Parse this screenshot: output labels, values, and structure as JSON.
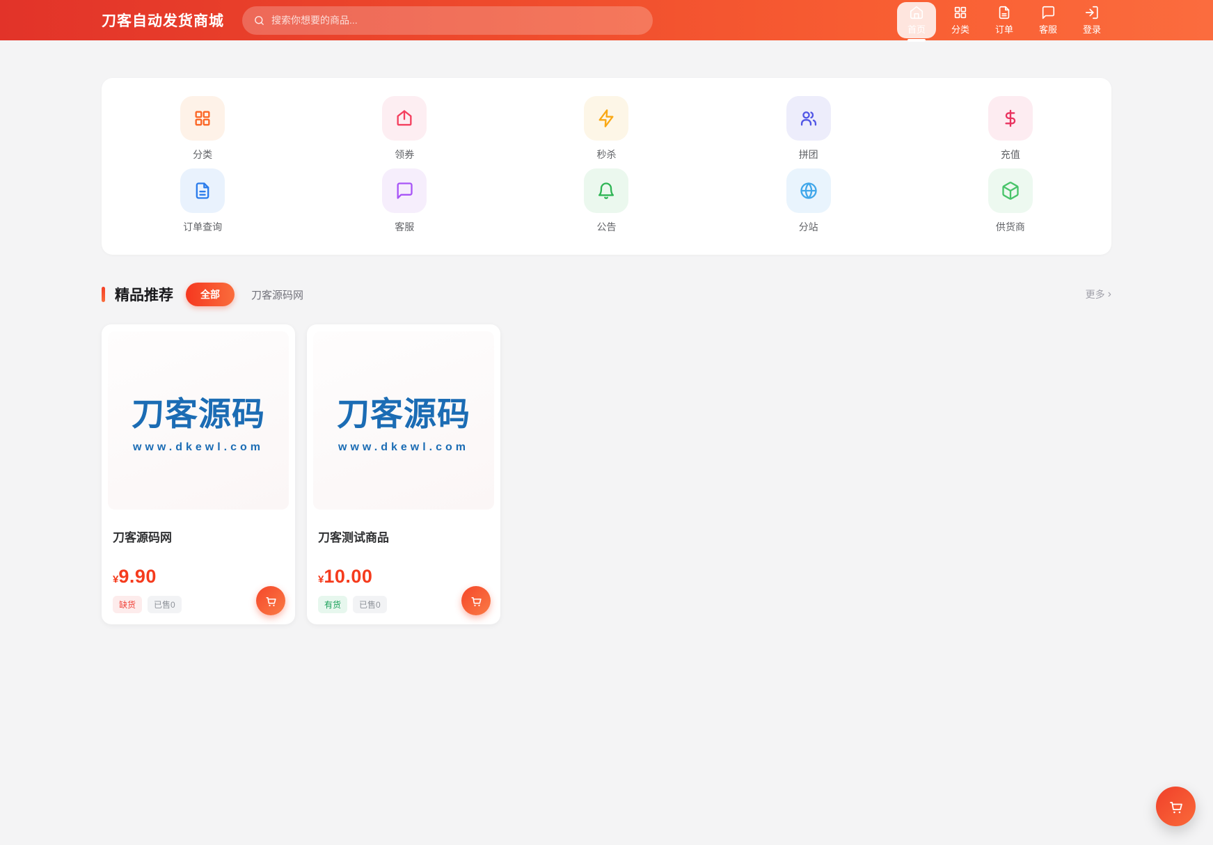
{
  "header": {
    "logo": "刀客自动发货商城",
    "search_placeholder": "搜索你想要的商品...",
    "nav": [
      {
        "label": "首页",
        "icon": "home-icon",
        "active": true
      },
      {
        "label": "分类",
        "icon": "grid-icon",
        "active": false
      },
      {
        "label": "订单",
        "icon": "document-icon",
        "active": false
      },
      {
        "label": "客服",
        "icon": "chat-icon",
        "active": false
      },
      {
        "label": "登录",
        "icon": "login-icon",
        "active": false
      }
    ]
  },
  "quick_links": [
    {
      "label": "分类",
      "icon": "grid-icon",
      "color": "#fb6524",
      "bg": "#fef2e8"
    },
    {
      "label": "领券",
      "icon": "coupon-icon",
      "color": "#f43f5e",
      "bg": "#fdeef2"
    },
    {
      "label": "秒杀",
      "icon": "lightning-icon",
      "color": "#f9a815",
      "bg": "#fdf6e7"
    },
    {
      "label": "拼团",
      "icon": "group-icon",
      "color": "#5156e5",
      "bg": "#ededfb"
    },
    {
      "label": "充值",
      "icon": "dollar-icon",
      "color": "#e9325f",
      "bg": "#fdecf1"
    },
    {
      "label": "订单查询",
      "icon": "file-icon",
      "color": "#2b7ceb",
      "bg": "#e9f2fd"
    },
    {
      "label": "客服",
      "icon": "chat-icon",
      "color": "#a855f7",
      "bg": "#f6eefc"
    },
    {
      "label": "公告",
      "icon": "bell-icon",
      "color": "#2eb554",
      "bg": "#ebf8ee"
    },
    {
      "label": "分站",
      "icon": "globe-icon",
      "color": "#41a7ea",
      "bg": "#e9f4fd"
    },
    {
      "label": "供货商",
      "icon": "box-icon",
      "color": "#49c46a",
      "bg": "#edf9f0"
    }
  ],
  "section": {
    "title": "精品推荐",
    "tabs": [
      {
        "label": "全部",
        "active": true
      },
      {
        "label": "刀客源码网",
        "active": false
      }
    ],
    "more_label": "更多",
    "more_chevron": "›"
  },
  "products": [
    {
      "title": "刀客源码网",
      "currency": "¥",
      "price": "9.90",
      "stock_label": "缺货",
      "stock_state": "out",
      "sold_label": "已售0",
      "image_title": "刀客源码",
      "image_subtitle": "www.dkewl.com"
    },
    {
      "title": "刀客测试商品",
      "currency": "¥",
      "price": "10.00",
      "stock_label": "有货",
      "stock_state": "in",
      "sold_label": "已售0",
      "image_title": "刀客源码",
      "image_subtitle": "www.dkewl.com"
    }
  ],
  "colors": {
    "header_gradient_start": "#e23329",
    "header_gradient_end": "#fb6c3e",
    "accent": "#f5371f",
    "price": "#f53b1d",
    "product_logo_blue": "#1b6cb4"
  }
}
